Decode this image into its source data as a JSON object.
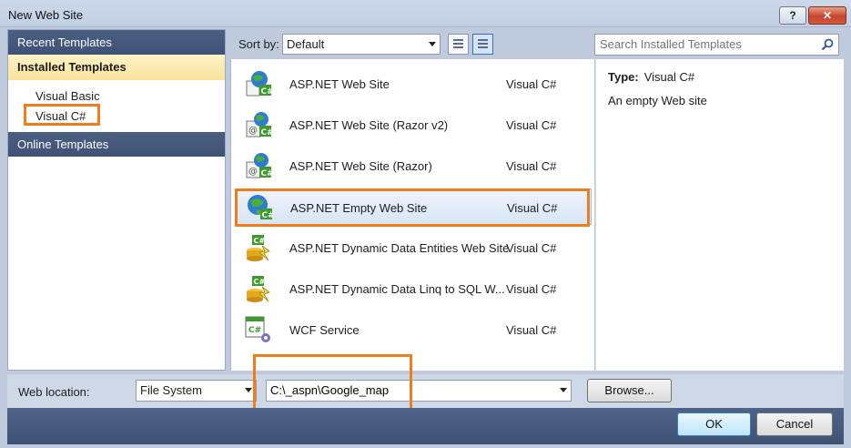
{
  "window": {
    "title": "New Web Site",
    "help_label": "?",
    "close_label": "✕"
  },
  "left_nav": {
    "recent": "Recent Templates",
    "installed": "Installed Templates",
    "languages": [
      "Visual Basic",
      "Visual C#"
    ],
    "online": "Online Templates"
  },
  "toolbar": {
    "sort_label": "Sort by:",
    "sort_value": "Default",
    "search_placeholder": "Search Installed Templates"
  },
  "templates": [
    {
      "name": "ASP.NET Web Site",
      "lang": "Visual C#",
      "icon": "globe-page-csharp-icon"
    },
    {
      "name": "ASP.NET Web Site (Razor v2)",
      "lang": "Visual C#",
      "icon": "globe-razor-csharp-icon"
    },
    {
      "name": "ASP.NET Web Site (Razor)",
      "lang": "Visual C#",
      "icon": "globe-razor-csharp-icon"
    },
    {
      "name": "ASP.NET Empty Web Site",
      "lang": "Visual C#",
      "icon": "globe-csharp-icon"
    },
    {
      "name": "ASP.NET Dynamic Data Entities Web Site",
      "lang": "Visual C#",
      "icon": "dynamic-data-csharp-icon"
    },
    {
      "name": "ASP.NET Dynamic Data Linq to SQL W...",
      "lang": "Visual C#",
      "icon": "dynamic-data-csharp-icon"
    },
    {
      "name": "WCF Service",
      "lang": "Visual C#",
      "icon": "wcf-service-csharp-icon"
    }
  ],
  "selected_index": 3,
  "details": {
    "type_label": "Type:",
    "type_value": "Visual C#",
    "description": "An empty Web site"
  },
  "location": {
    "label": "Web location:",
    "type_value": "File System",
    "path_value": "C:\\_aspn\\Google_map",
    "browse_label": "Browse..."
  },
  "buttons": {
    "ok": "OK",
    "cancel": "Cancel"
  },
  "colors": {
    "highlight": "#f07d1b",
    "nav_header": "#44577b",
    "installed_bg": "#fbebb0"
  }
}
